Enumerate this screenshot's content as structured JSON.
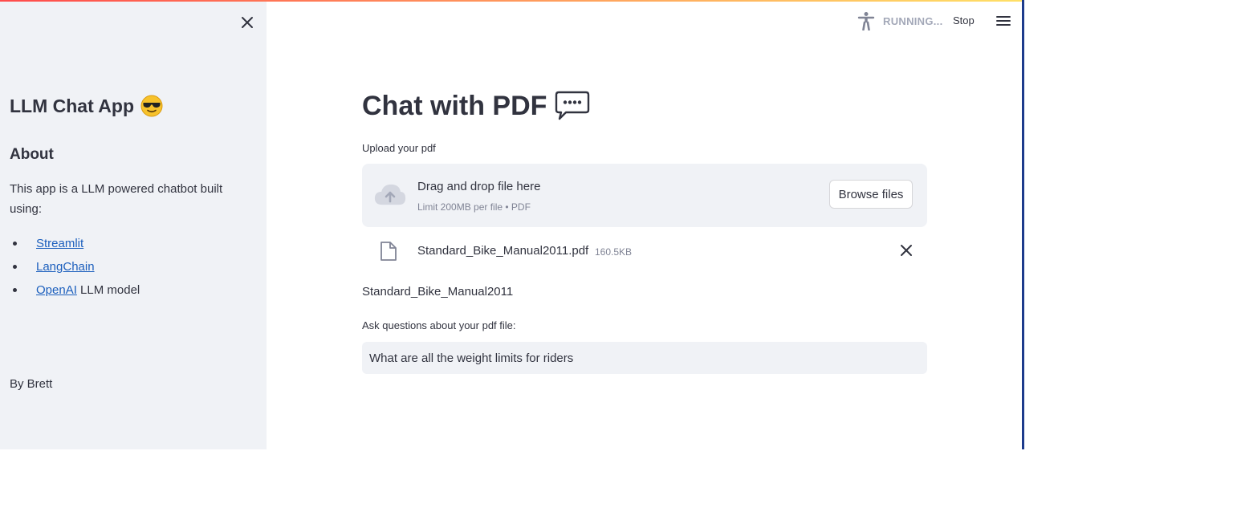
{
  "sidebar": {
    "title": "LLM Chat App",
    "title_emoji": "smiling-face-with-sunglasses-icon",
    "about_heading": "About",
    "description": "This app is a LLM powered chatbot built using:",
    "links": [
      {
        "label": "Streamlit",
        "suffix": ""
      },
      {
        "label": "LangChain",
        "suffix": ""
      },
      {
        "label": "OpenAI",
        "suffix": " LLM model"
      }
    ],
    "byline": "By Brett"
  },
  "toolbar": {
    "status": "RUNNING...",
    "stop_label": "Stop"
  },
  "main": {
    "title": "Chat with PDF",
    "title_icon": "speech-bubble-icon",
    "upload_label": "Upload your pdf",
    "dropzone": {
      "title": "Drag and drop file here",
      "limit": "Limit 200MB per file • PDF",
      "browse_label": "Browse files"
    },
    "uploaded_file": {
      "name": "Standard_Bike_Manual2011.pdf",
      "size": "160.5KB"
    },
    "document_name": "Standard_Bike_Manual2011",
    "question_label": "Ask questions about your pdf file:",
    "question_value": "What are all the weight limits for riders"
  },
  "colors": {
    "sidebar_bg": "#f0f2f6",
    "text": "#31333f",
    "link": "#1c5fbd",
    "muted": "#808495",
    "top_gradient_start": "#ff4b4b",
    "top_gradient_end": "#ffe066",
    "right_edge": "#1d3b8c"
  }
}
